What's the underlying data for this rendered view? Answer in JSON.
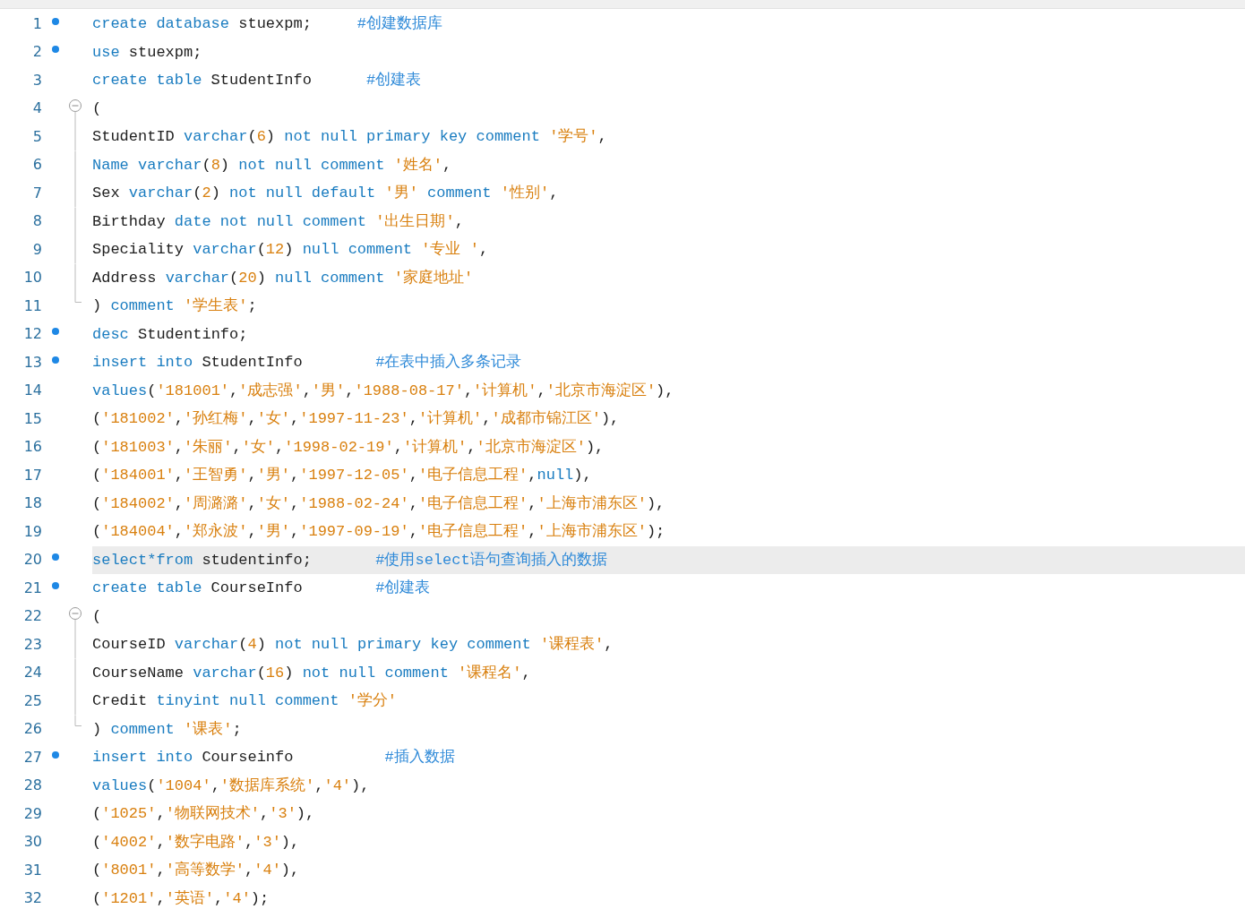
{
  "lines": [
    {
      "number": "1",
      "kind": "breakpoint",
      "highlighted": false,
      "tokens": [
        {
          "kind": "keyword",
          "text": "create database"
        },
        {
          "kind": "plain",
          "text": " stuexpm;     "
        },
        {
          "kind": "comment",
          "text": "#创建数据库"
        }
      ]
    },
    {
      "number": "2",
      "kind": "breakpoint",
      "highlighted": false,
      "tokens": [
        {
          "kind": "keyword",
          "text": "use"
        },
        {
          "kind": "plain",
          "text": " stuexpm;"
        }
      ]
    },
    {
      "number": "3",
      "kind": "plain",
      "highlighted": false,
      "tokens": [
        {
          "kind": "keyword",
          "text": "create table"
        },
        {
          "kind": "plain",
          "text": " StudentInfo      "
        },
        {
          "kind": "comment",
          "text": "#创建表"
        }
      ]
    },
    {
      "number": "4",
      "kind": "fold-start",
      "highlighted": false,
      "tokens": [
        {
          "kind": "plain",
          "text": "("
        }
      ]
    },
    {
      "number": "5",
      "kind": "fold-body",
      "highlighted": false,
      "tokens": [
        {
          "kind": "plain",
          "text": "StudentID "
        },
        {
          "kind": "keyword",
          "text": "varchar"
        },
        {
          "kind": "plain",
          "text": "("
        },
        {
          "kind": "number",
          "text": "6"
        },
        {
          "kind": "plain",
          "text": ") "
        },
        {
          "kind": "keyword",
          "text": "not null primary key comment "
        },
        {
          "kind": "string",
          "text": "'学号'"
        },
        {
          "kind": "plain",
          "text": ","
        }
      ]
    },
    {
      "number": "6",
      "kind": "fold-body",
      "highlighted": false,
      "tokens": [
        {
          "kind": "keyword",
          "text": "Name varchar"
        },
        {
          "kind": "plain",
          "text": "("
        },
        {
          "kind": "number",
          "text": "8"
        },
        {
          "kind": "plain",
          "text": ") "
        },
        {
          "kind": "keyword",
          "text": "not null comment "
        },
        {
          "kind": "string",
          "text": "'姓名'"
        },
        {
          "kind": "plain",
          "text": ","
        }
      ]
    },
    {
      "number": "7",
      "kind": "fold-body",
      "highlighted": false,
      "tokens": [
        {
          "kind": "plain",
          "text": "Sex "
        },
        {
          "kind": "keyword",
          "text": "varchar"
        },
        {
          "kind": "plain",
          "text": "("
        },
        {
          "kind": "number",
          "text": "2"
        },
        {
          "kind": "plain",
          "text": ") "
        },
        {
          "kind": "keyword",
          "text": "not null default "
        },
        {
          "kind": "string",
          "text": "'男'"
        },
        {
          "kind": "keyword",
          "text": " comment "
        },
        {
          "kind": "string",
          "text": "'性别'"
        },
        {
          "kind": "plain",
          "text": ","
        }
      ]
    },
    {
      "number": "8",
      "kind": "fold-body",
      "highlighted": false,
      "tokens": [
        {
          "kind": "plain",
          "text": "Birthday "
        },
        {
          "kind": "keyword",
          "text": "date not null comment "
        },
        {
          "kind": "string",
          "text": "'出生日期'"
        },
        {
          "kind": "plain",
          "text": ","
        }
      ]
    },
    {
      "number": "9",
      "kind": "fold-body",
      "highlighted": false,
      "tokens": [
        {
          "kind": "plain",
          "text": "Speciality "
        },
        {
          "kind": "keyword",
          "text": "varchar"
        },
        {
          "kind": "plain",
          "text": "("
        },
        {
          "kind": "number",
          "text": "12"
        },
        {
          "kind": "plain",
          "text": ") "
        },
        {
          "kind": "keyword",
          "text": "null comment "
        },
        {
          "kind": "string",
          "text": "'专业 '"
        },
        {
          "kind": "plain",
          "text": ","
        }
      ]
    },
    {
      "number": "10",
      "kind": "fold-body",
      "highlighted": false,
      "tokens": [
        {
          "kind": "plain",
          "text": "Address "
        },
        {
          "kind": "keyword",
          "text": "varchar"
        },
        {
          "kind": "plain",
          "text": "("
        },
        {
          "kind": "number",
          "text": "20"
        },
        {
          "kind": "plain",
          "text": ") "
        },
        {
          "kind": "keyword",
          "text": "null comment "
        },
        {
          "kind": "string",
          "text": "'家庭地址'"
        }
      ]
    },
    {
      "number": "11",
      "kind": "fold-end",
      "highlighted": false,
      "tokens": [
        {
          "kind": "plain",
          "text": ") "
        },
        {
          "kind": "keyword",
          "text": "comment "
        },
        {
          "kind": "string",
          "text": "'学生表'"
        },
        {
          "kind": "plain",
          "text": ";"
        }
      ]
    },
    {
      "number": "12",
      "kind": "breakpoint",
      "highlighted": false,
      "tokens": [
        {
          "kind": "keyword",
          "text": "desc"
        },
        {
          "kind": "plain",
          "text": " Studentinfo;"
        }
      ]
    },
    {
      "number": "13",
      "kind": "breakpoint",
      "highlighted": false,
      "tokens": [
        {
          "kind": "keyword",
          "text": "insert into"
        },
        {
          "kind": "plain",
          "text": " StudentInfo        "
        },
        {
          "kind": "comment",
          "text": "#在表中插入多条记录"
        }
      ]
    },
    {
      "number": "14",
      "kind": "plain",
      "highlighted": false,
      "tokens": [
        {
          "kind": "keyword",
          "text": "values"
        },
        {
          "kind": "plain",
          "text": "("
        },
        {
          "kind": "string",
          "text": "'181001'"
        },
        {
          "kind": "plain",
          "text": ","
        },
        {
          "kind": "string",
          "text": "'成志强'"
        },
        {
          "kind": "plain",
          "text": ","
        },
        {
          "kind": "string",
          "text": "'男'"
        },
        {
          "kind": "plain",
          "text": ","
        },
        {
          "kind": "string",
          "text": "'1988-08-17'"
        },
        {
          "kind": "plain",
          "text": ","
        },
        {
          "kind": "string",
          "text": "'计算机'"
        },
        {
          "kind": "plain",
          "text": ","
        },
        {
          "kind": "string",
          "text": "'北京市海淀区'"
        },
        {
          "kind": "plain",
          "text": "),"
        }
      ]
    },
    {
      "number": "15",
      "kind": "plain",
      "highlighted": false,
      "tokens": [
        {
          "kind": "plain",
          "text": "("
        },
        {
          "kind": "string",
          "text": "'181002'"
        },
        {
          "kind": "plain",
          "text": ","
        },
        {
          "kind": "string",
          "text": "'孙红梅'"
        },
        {
          "kind": "plain",
          "text": ","
        },
        {
          "kind": "string",
          "text": "'女'"
        },
        {
          "kind": "plain",
          "text": ","
        },
        {
          "kind": "string",
          "text": "'1997-11-23'"
        },
        {
          "kind": "plain",
          "text": ","
        },
        {
          "kind": "string",
          "text": "'计算机'"
        },
        {
          "kind": "plain",
          "text": ","
        },
        {
          "kind": "string",
          "text": "'成都市锦江区'"
        },
        {
          "kind": "plain",
          "text": "),"
        }
      ]
    },
    {
      "number": "16",
      "kind": "plain",
      "highlighted": false,
      "tokens": [
        {
          "kind": "plain",
          "text": "("
        },
        {
          "kind": "string",
          "text": "'181003'"
        },
        {
          "kind": "plain",
          "text": ","
        },
        {
          "kind": "string",
          "text": "'朱丽'"
        },
        {
          "kind": "plain",
          "text": ","
        },
        {
          "kind": "string",
          "text": "'女'"
        },
        {
          "kind": "plain",
          "text": ","
        },
        {
          "kind": "string",
          "text": "'1998-02-19'"
        },
        {
          "kind": "plain",
          "text": ","
        },
        {
          "kind": "string",
          "text": "'计算机'"
        },
        {
          "kind": "plain",
          "text": ","
        },
        {
          "kind": "string",
          "text": "'北京市海淀区'"
        },
        {
          "kind": "plain",
          "text": "),"
        }
      ]
    },
    {
      "number": "17",
      "kind": "plain",
      "highlighted": false,
      "tokens": [
        {
          "kind": "plain",
          "text": "("
        },
        {
          "kind": "string",
          "text": "'184001'"
        },
        {
          "kind": "plain",
          "text": ","
        },
        {
          "kind": "string",
          "text": "'王智勇'"
        },
        {
          "kind": "plain",
          "text": ","
        },
        {
          "kind": "string",
          "text": "'男'"
        },
        {
          "kind": "plain",
          "text": ","
        },
        {
          "kind": "string",
          "text": "'1997-12-05'"
        },
        {
          "kind": "plain",
          "text": ","
        },
        {
          "kind": "string",
          "text": "'电子信息工程'"
        },
        {
          "kind": "plain",
          "text": ","
        },
        {
          "kind": "keyword",
          "text": "null"
        },
        {
          "kind": "plain",
          "text": "),"
        }
      ]
    },
    {
      "number": "18",
      "kind": "plain",
      "highlighted": false,
      "tokens": [
        {
          "kind": "plain",
          "text": "("
        },
        {
          "kind": "string",
          "text": "'184002'"
        },
        {
          "kind": "plain",
          "text": ","
        },
        {
          "kind": "string",
          "text": "'周潞潞'"
        },
        {
          "kind": "plain",
          "text": ","
        },
        {
          "kind": "string",
          "text": "'女'"
        },
        {
          "kind": "plain",
          "text": ","
        },
        {
          "kind": "string",
          "text": "'1988-02-24'"
        },
        {
          "kind": "plain",
          "text": ","
        },
        {
          "kind": "string",
          "text": "'电子信息工程'"
        },
        {
          "kind": "plain",
          "text": ","
        },
        {
          "kind": "string",
          "text": "'上海市浦东区'"
        },
        {
          "kind": "plain",
          "text": "),"
        }
      ]
    },
    {
      "number": "19",
      "kind": "plain",
      "highlighted": false,
      "tokens": [
        {
          "kind": "plain",
          "text": "("
        },
        {
          "kind": "string",
          "text": "'184004'"
        },
        {
          "kind": "plain",
          "text": ","
        },
        {
          "kind": "string",
          "text": "'郑永波'"
        },
        {
          "kind": "plain",
          "text": ","
        },
        {
          "kind": "string",
          "text": "'男'"
        },
        {
          "kind": "plain",
          "text": ","
        },
        {
          "kind": "string",
          "text": "'1997-09-19'"
        },
        {
          "kind": "plain",
          "text": ","
        },
        {
          "kind": "string",
          "text": "'电子信息工程'"
        },
        {
          "kind": "plain",
          "text": ","
        },
        {
          "kind": "string",
          "text": "'上海市浦东区'"
        },
        {
          "kind": "plain",
          "text": ");"
        }
      ]
    },
    {
      "number": "20",
      "kind": "breakpoint",
      "highlighted": true,
      "tokens": [
        {
          "kind": "keyword",
          "text": "select*from"
        },
        {
          "kind": "plain",
          "text": " studentinfo;       "
        },
        {
          "kind": "comment",
          "text": "#使用select语句查询插入的数据"
        }
      ]
    },
    {
      "number": "21",
      "kind": "breakpoint",
      "highlighted": false,
      "tokens": [
        {
          "kind": "keyword",
          "text": "create table"
        },
        {
          "kind": "plain",
          "text": " CourseInfo        "
        },
        {
          "kind": "comment",
          "text": "#创建表"
        }
      ]
    },
    {
      "number": "22",
      "kind": "fold-start",
      "highlighted": false,
      "tokens": [
        {
          "kind": "plain",
          "text": "("
        }
      ]
    },
    {
      "number": "23",
      "kind": "fold-body",
      "highlighted": false,
      "tokens": [
        {
          "kind": "plain",
          "text": "CourseID "
        },
        {
          "kind": "keyword",
          "text": "varchar"
        },
        {
          "kind": "plain",
          "text": "("
        },
        {
          "kind": "number",
          "text": "4"
        },
        {
          "kind": "plain",
          "text": ") "
        },
        {
          "kind": "keyword",
          "text": "not null primary key comment "
        },
        {
          "kind": "string",
          "text": "'课程表'"
        },
        {
          "kind": "plain",
          "text": ","
        }
      ]
    },
    {
      "number": "24",
      "kind": "fold-body",
      "highlighted": false,
      "tokens": [
        {
          "kind": "plain",
          "text": "CourseName "
        },
        {
          "kind": "keyword",
          "text": "varchar"
        },
        {
          "kind": "plain",
          "text": "("
        },
        {
          "kind": "number",
          "text": "16"
        },
        {
          "kind": "plain",
          "text": ") "
        },
        {
          "kind": "keyword",
          "text": "not null comment "
        },
        {
          "kind": "string",
          "text": "'课程名'"
        },
        {
          "kind": "plain",
          "text": ","
        }
      ]
    },
    {
      "number": "25",
      "kind": "fold-body",
      "highlighted": false,
      "tokens": [
        {
          "kind": "plain",
          "text": "Credit "
        },
        {
          "kind": "keyword",
          "text": "tinyint null comment "
        },
        {
          "kind": "string",
          "text": "'学分'"
        }
      ]
    },
    {
      "number": "26",
      "kind": "fold-end",
      "highlighted": false,
      "tokens": [
        {
          "kind": "plain",
          "text": ") "
        },
        {
          "kind": "keyword",
          "text": "comment "
        },
        {
          "kind": "string",
          "text": "'课表'"
        },
        {
          "kind": "plain",
          "text": ";"
        }
      ]
    },
    {
      "number": "27",
      "kind": "breakpoint",
      "highlighted": false,
      "tokens": [
        {
          "kind": "keyword",
          "text": "insert into"
        },
        {
          "kind": "plain",
          "text": " Courseinfo          "
        },
        {
          "kind": "comment",
          "text": "#插入数据"
        }
      ]
    },
    {
      "number": "28",
      "kind": "plain",
      "highlighted": false,
      "tokens": [
        {
          "kind": "keyword",
          "text": "values"
        },
        {
          "kind": "plain",
          "text": "("
        },
        {
          "kind": "string",
          "text": "'1004'"
        },
        {
          "kind": "plain",
          "text": ","
        },
        {
          "kind": "string",
          "text": "'数据库系统'"
        },
        {
          "kind": "plain",
          "text": ","
        },
        {
          "kind": "string",
          "text": "'4'"
        },
        {
          "kind": "plain",
          "text": "),"
        }
      ]
    },
    {
      "number": "29",
      "kind": "plain",
      "highlighted": false,
      "tokens": [
        {
          "kind": "plain",
          "text": "("
        },
        {
          "kind": "string",
          "text": "'1025'"
        },
        {
          "kind": "plain",
          "text": ","
        },
        {
          "kind": "string",
          "text": "'物联网技术'"
        },
        {
          "kind": "plain",
          "text": ","
        },
        {
          "kind": "string",
          "text": "'3'"
        },
        {
          "kind": "plain",
          "text": "),"
        }
      ]
    },
    {
      "number": "30",
      "kind": "plain",
      "highlighted": false,
      "tokens": [
        {
          "kind": "plain",
          "text": "("
        },
        {
          "kind": "string",
          "text": "'4002'"
        },
        {
          "kind": "plain",
          "text": ","
        },
        {
          "kind": "string",
          "text": "'数字电路'"
        },
        {
          "kind": "plain",
          "text": ","
        },
        {
          "kind": "string",
          "text": "'3'"
        },
        {
          "kind": "plain",
          "text": "),"
        }
      ]
    },
    {
      "number": "31",
      "kind": "plain",
      "highlighted": false,
      "tokens": [
        {
          "kind": "plain",
          "text": "("
        },
        {
          "kind": "string",
          "text": "'8001'"
        },
        {
          "kind": "plain",
          "text": ","
        },
        {
          "kind": "string",
          "text": "'高等数学'"
        },
        {
          "kind": "plain",
          "text": ","
        },
        {
          "kind": "string",
          "text": "'4'"
        },
        {
          "kind": "plain",
          "text": "),"
        }
      ]
    },
    {
      "number": "32",
      "kind": "plain",
      "highlighted": false,
      "tokens": [
        {
          "kind": "plain",
          "text": "("
        },
        {
          "kind": "string",
          "text": "'1201'"
        },
        {
          "kind": "plain",
          "text": ","
        },
        {
          "kind": "string",
          "text": "'英语'"
        },
        {
          "kind": "plain",
          "text": ","
        },
        {
          "kind": "string",
          "text": "'4'"
        },
        {
          "kind": "plain",
          "text": ");"
        }
      ]
    }
  ]
}
